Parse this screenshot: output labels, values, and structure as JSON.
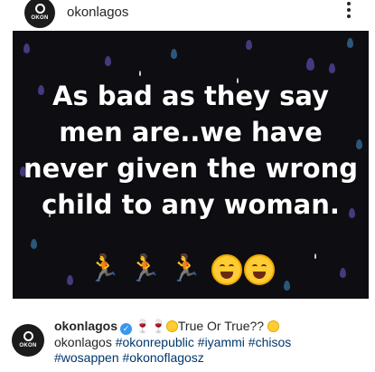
{
  "header": {
    "username": "okonlagos",
    "avatar_text": "OKON"
  },
  "post": {
    "lines": [
      "As bad as they say",
      "men are..we have",
      "never given the wrong",
      "child to any woman."
    ],
    "emoji_icons": [
      "running-man-icon",
      "running-man-icon",
      "running-man-icon",
      "grinning-squint-face-icon",
      "grinning-face-icon"
    ]
  },
  "caption": {
    "avatar_text": "OKON",
    "username": "okonlagos",
    "text": "True Or True??",
    "mention": "okonlagos",
    "hashtags": [
      "#okonrepublic",
      "#iyammi",
      "#chisos",
      "#wosappen",
      "#okonoflagosz"
    ]
  },
  "colors": {
    "post_background": "#0e0e12",
    "raindrop_purple": "#4a3f8c",
    "hashtag": "#00376b",
    "verified_badge": "#3897f0"
  }
}
